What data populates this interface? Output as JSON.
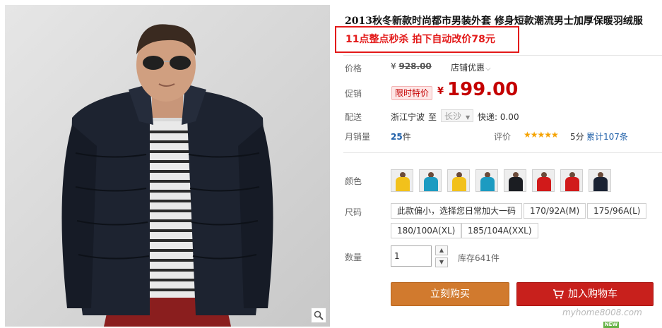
{
  "product": {
    "title": "2013秋冬新款时尚都市男装外套 修身短款潮流男士加厚保暖羽绒服",
    "promo": "11点整点秒杀 拍下自动改价78元"
  },
  "price_row": {
    "label": "价格",
    "original_price": "928.00",
    "currency": "¥",
    "shop_promo": "店铺优惠"
  },
  "promo_row": {
    "label": "促销",
    "badge": "限时特价",
    "currency": "¥",
    "price": "199.00"
  },
  "shipping": {
    "label": "配送",
    "from": "浙江宁波",
    "to_word": "至",
    "to_city": "长沙",
    "fee": "快递: 0.00"
  },
  "sales": {
    "label": "月销量",
    "count": "25",
    "unit": "件",
    "rating_label": "评价",
    "stars": "★★★★★",
    "score": "5分",
    "reviews": "累计107条"
  },
  "colors": {
    "label": "颜色",
    "swatches": [
      {
        "name": "yellow",
        "color": "#f2c11b"
      },
      {
        "name": "teal",
        "color": "#1c9bc1"
      },
      {
        "name": "yellow",
        "color": "#f2c11b"
      },
      {
        "name": "teal",
        "color": "#1c9bc1"
      },
      {
        "name": "black",
        "color": "#1b1d22"
      },
      {
        "name": "red",
        "color": "#d11a1a"
      },
      {
        "name": "red",
        "color": "#d11a1a"
      },
      {
        "name": "navy",
        "color": "#1a2233"
      }
    ]
  },
  "sizes": {
    "label": "尺码",
    "options": [
      "此款偏小，选择您日常加大一码",
      "170/92A(M)",
      "175/96A(L)",
      "180/100A(XL)",
      "185/104A(XXL)"
    ]
  },
  "quantity": {
    "label": "数量",
    "value": "1",
    "stock": "库存641件"
  },
  "actions": {
    "buy_now": "立刻购买",
    "add_to_cart": "加入购物车"
  },
  "watermark": "myhome8008.com",
  "new_badge": "NEW",
  "colors_theme": {
    "accent_red": "#c40000",
    "buy_orange": "#d17a2e",
    "cart_red": "#c8201c",
    "link_blue": "#1f5fa8"
  }
}
